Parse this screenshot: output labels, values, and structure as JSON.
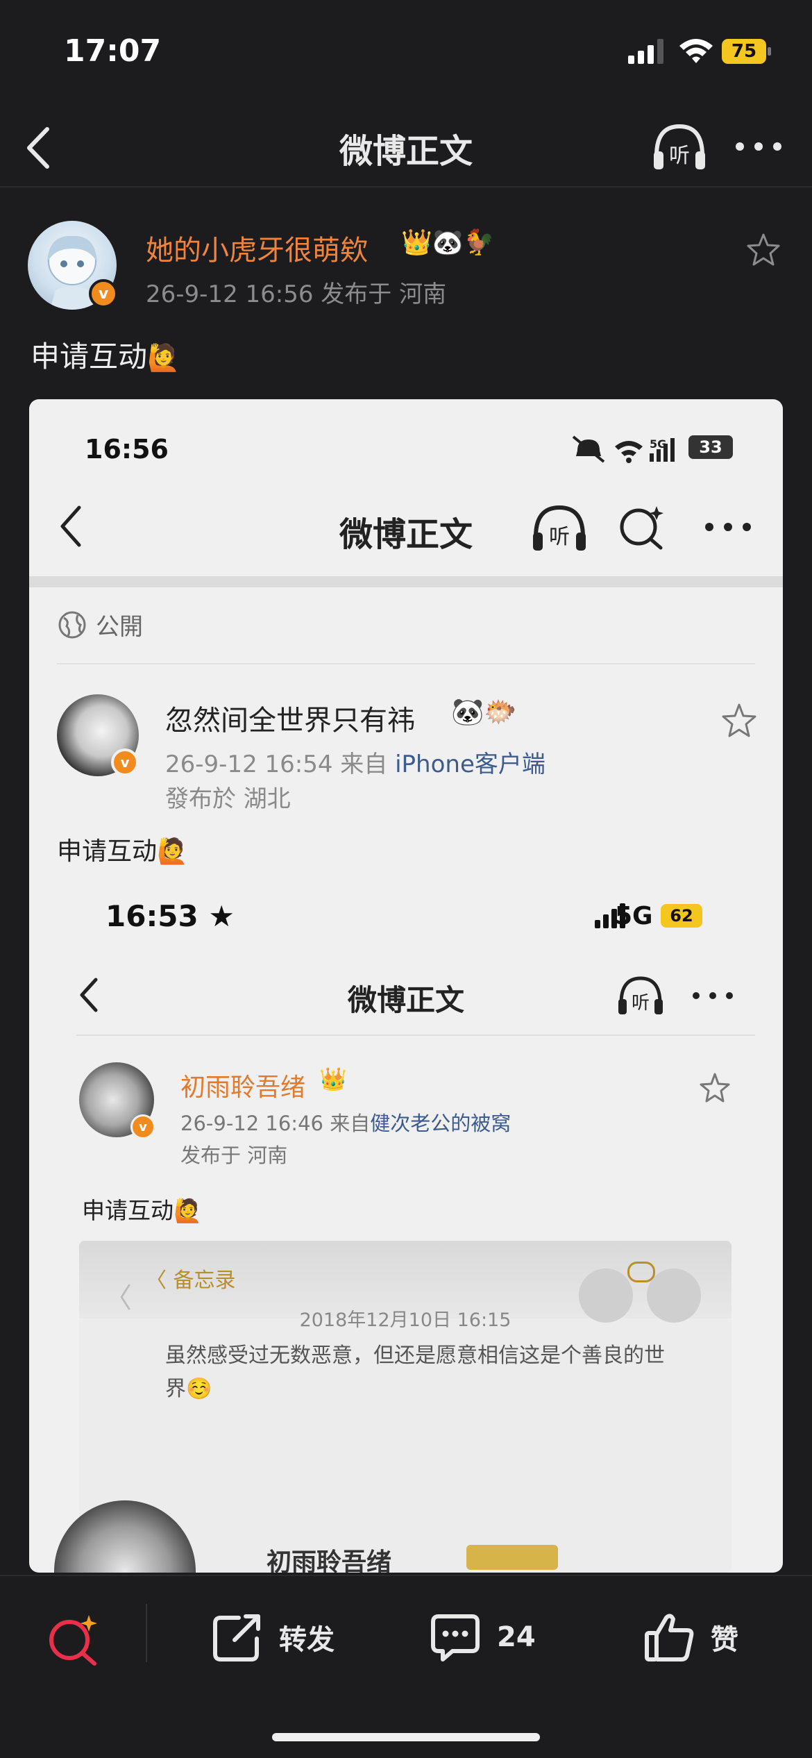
{
  "status_bar": {
    "time": "17:07",
    "battery": "75"
  },
  "nav": {
    "title": "微博正文"
  },
  "post": {
    "author": "她的小虎牙很萌欸",
    "author_badges": "👑🐼🐓",
    "verified": "v",
    "meta": "26-9-12 16:56  发布于 河南",
    "text": "申请互动",
    "text_emoji": "🙋"
  },
  "screenshot": {
    "time": "16:56",
    "battery": "33",
    "title": "微博正文",
    "visibility": "公開",
    "author": "忽然间全世界只有祎",
    "author_badges": "🐼🐡",
    "verified": "v",
    "meta_prefix": "26-9-12 16:54  来自 ",
    "meta_source": "iPhone客户端",
    "location": "發布於 湖北",
    "text": "申请互动🙋",
    "nested": {
      "time": "16:53 ★",
      "network": "5G",
      "battery": "62",
      "title": "微博正文",
      "author": "初雨聆吾绪",
      "author_badges": "👑",
      "verified": "v",
      "meta_prefix": "26-9-12 16:46  来自",
      "meta_source": "健次老公的被窝",
      "location": "发布于 河南",
      "text": "申请互动🙋",
      "memo": {
        "back_label": "〈 备忘录",
        "date": "2018年12月10日 16:15",
        "content": "虽然感受过无数恶意，但还是愿意相信这是个善良的世界☺️",
        "partial_name": "初雨聆吾绪"
      }
    }
  },
  "bottom_bar": {
    "repost_label": "转发",
    "comment_count": "24",
    "like_label": "赞"
  },
  "colors": {
    "accent_orange": "#f0843c",
    "background": "#1c1c1e",
    "verified_badge": "#f28b1e",
    "search_accent": "#e8304a"
  }
}
